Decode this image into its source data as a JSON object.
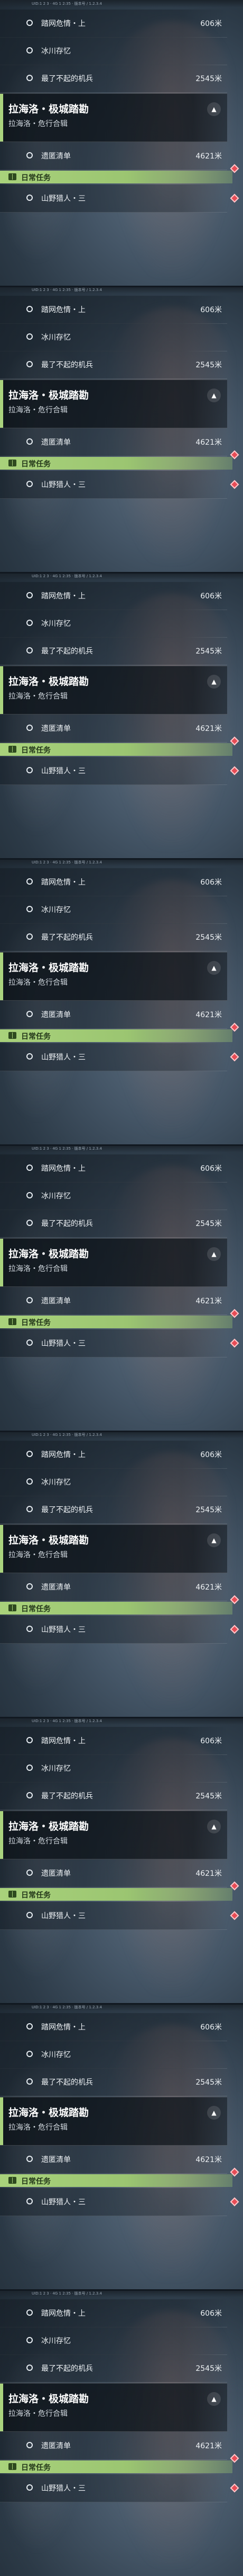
{
  "status_bar_text": "UID:1 2 3 · 4G 1 2:35 · 版本号 / 1.2.3.4",
  "quests": {
    "items": [
      {
        "label": "踏网危情・上",
        "distance": "606米"
      },
      {
        "label": "冰川存忆",
        "distance": ""
      },
      {
        "label": "最了不起的机兵",
        "distance": "2545米"
      }
    ],
    "main": {
      "title": "拉海洛・极城踏勘",
      "subtitle": "拉海洛・危行合辑",
      "collapse_icon": "chevron-up-icon",
      "item_label": "遗匿清单",
      "item_distance": "4621米"
    },
    "daily": {
      "label": "日常任务",
      "icon": "book-icon",
      "item_label": "山野猎人・三",
      "marker_icon": "diamond-marker-icon"
    }
  },
  "colors": {
    "accent_green": "#aad37e",
    "marker_red": "#e74c56",
    "panel_dark": "#0c1218"
  }
}
